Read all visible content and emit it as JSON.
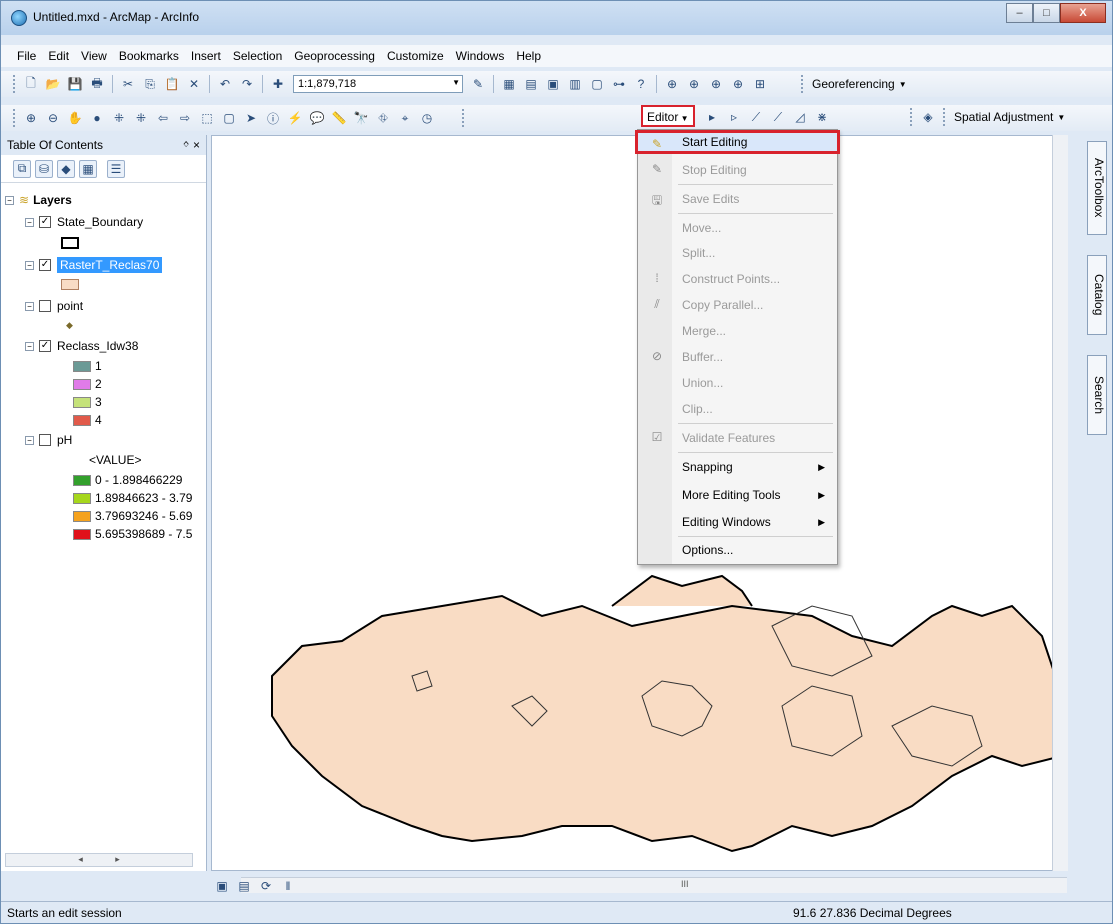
{
  "window": {
    "title": "Untitled.mxd - ArcMap - ArcInfo",
    "buttons": {
      "minimize": "–",
      "maximize": "□",
      "close": "X"
    }
  },
  "menubar": [
    "File",
    "Edit",
    "View",
    "Bookmarks",
    "Insert",
    "Selection",
    "Geoprocessing",
    "Customize",
    "Windows",
    "Help"
  ],
  "toolbar": {
    "scale": "1:1,879,718",
    "georeferencing": "Georeferencing",
    "editor": "Editor",
    "spatial_adjustment": "Spatial Adjustment"
  },
  "toc": {
    "title": "Table Of Contents",
    "pin": "ᛜ ×",
    "root": "Layers",
    "layers": [
      {
        "name": "State_Boundary",
        "checked": true
      },
      {
        "name": "RasterT_Reclas70",
        "checked": true,
        "selected": true
      },
      {
        "name": "point",
        "checked": false
      },
      {
        "name": "Reclass_Idw38",
        "checked": true,
        "classes": [
          "1",
          "2",
          "3",
          "4"
        ],
        "colors": [
          "#6b9a96",
          "#e07be8",
          "#c5e27a",
          "#e15a4a"
        ]
      },
      {
        "name": "pH",
        "checked": false,
        "field": "<VALUE>",
        "classes": [
          "0 - 1.898466229",
          "1.89846623 - 3.79",
          "3.79693246 - 5.69",
          "5.695398689 - 7.5"
        ],
        "colors": [
          "#33a02c",
          "#a6d71c",
          "#f5a21d",
          "#e0101a"
        ]
      }
    ]
  },
  "editor_menu": {
    "items": [
      {
        "label": "Start Editing",
        "enabled": true,
        "icon": "pencil-icon"
      },
      {
        "label": "Stop Editing",
        "enabled": false,
        "icon": "pencil-stop-icon"
      },
      {
        "label": "Save Edits",
        "enabled": false,
        "icon": "save-icon"
      },
      {
        "label": "Move...",
        "enabled": false
      },
      {
        "label": "Split...",
        "enabled": false
      },
      {
        "label": "Construct Points...",
        "enabled": false,
        "icon": "construct-points-icon"
      },
      {
        "label": "Copy Parallel...",
        "enabled": false,
        "icon": "copy-parallel-icon"
      },
      {
        "label": "Merge...",
        "enabled": false
      },
      {
        "label": "Buffer...",
        "enabled": false,
        "icon": "buffer-icon"
      },
      {
        "label": "Union...",
        "enabled": false
      },
      {
        "label": "Clip...",
        "enabled": false
      },
      {
        "label": "Validate Features",
        "enabled": false,
        "icon": "validate-icon"
      },
      {
        "label": "Snapping",
        "enabled": true,
        "submenu": true
      },
      {
        "label": "More Editing Tools",
        "enabled": true,
        "submenu": true
      },
      {
        "label": "Editing Windows",
        "enabled": true,
        "submenu": true
      },
      {
        "label": "Options...",
        "enabled": true
      }
    ]
  },
  "side_tabs": [
    "ArcToolbox",
    "Catalog",
    "Search"
  ],
  "status": {
    "message": "Starts an edit session",
    "coords": "91.6  27.836 Decimal Degrees"
  },
  "hscroll_label": "III"
}
